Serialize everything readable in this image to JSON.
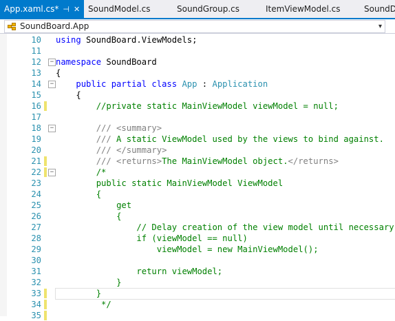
{
  "tabs": [
    {
      "label": "App.xaml.cs*",
      "active": true,
      "pin": "⊣",
      "close": "✕"
    },
    {
      "label": "SoundModel.cs",
      "active": false
    },
    {
      "label": "SoundGroup.cs",
      "active": false
    },
    {
      "label": "ItemViewModel.cs",
      "active": false
    },
    {
      "label": "SoundDa",
      "active": false
    }
  ],
  "nav": {
    "label": "SoundBoard.App",
    "icon": "class-icon",
    "arrow": "chevron-down-icon"
  },
  "lines": [
    {
      "n": "10",
      "segs": [
        [
          "kw",
          "using"
        ],
        [
          "tx",
          " SoundBoard.ViewModels;"
        ]
      ]
    },
    {
      "n": "11",
      "segs": []
    },
    {
      "n": "12",
      "fold": "−",
      "segs": [
        [
          "kw",
          "namespace"
        ],
        [
          "tx",
          " SoundBoard"
        ]
      ]
    },
    {
      "n": "13",
      "segs": [
        [
          "tx",
          "{"
        ]
      ]
    },
    {
      "n": "14",
      "fold": "−",
      "segs": [
        [
          "tx",
          "    "
        ],
        [
          "kw",
          "public partial class"
        ],
        [
          "tx",
          " "
        ],
        [
          "ty",
          "App"
        ],
        [
          "tx",
          " : "
        ],
        [
          "ty",
          "Application"
        ]
      ]
    },
    {
      "n": "15",
      "segs": [
        [
          "tx",
          "    {"
        ]
      ]
    },
    {
      "n": "16",
      "changed": true,
      "segs": [
        [
          "tx",
          "        "
        ],
        [
          "cm",
          "//private static MainViewModel viewModel = null;"
        ]
      ]
    },
    {
      "n": "17",
      "segs": []
    },
    {
      "n": "18",
      "fold": "−",
      "segs": [
        [
          "tx",
          "        "
        ],
        [
          "xml",
          "/// <summary>"
        ]
      ]
    },
    {
      "n": "19",
      "segs": [
        [
          "tx",
          "        "
        ],
        [
          "xml",
          "///"
        ],
        [
          "cm",
          " A static ViewModel used by the views to bind against."
        ]
      ]
    },
    {
      "n": "20",
      "segs": [
        [
          "tx",
          "        "
        ],
        [
          "xml",
          "/// </summary>"
        ]
      ]
    },
    {
      "n": "21",
      "changed": true,
      "segs": [
        [
          "tx",
          "        "
        ],
        [
          "xml",
          "/// <returns>"
        ],
        [
          "cm",
          "The MainViewModel object."
        ],
        [
          "xml",
          "</returns>"
        ]
      ]
    },
    {
      "n": "22",
      "changed": true,
      "fold": "−",
      "segs": [
        [
          "tx",
          "        "
        ],
        [
          "cm",
          "/*"
        ]
      ]
    },
    {
      "n": "23",
      "segs": [
        [
          "tx",
          "        "
        ],
        [
          "cm",
          "public static MainViewModel ViewModel"
        ]
      ]
    },
    {
      "n": "24",
      "segs": [
        [
          "tx",
          "        "
        ],
        [
          "cm",
          "{"
        ]
      ]
    },
    {
      "n": "25",
      "segs": [
        [
          "tx",
          "            "
        ],
        [
          "cm",
          "get"
        ]
      ]
    },
    {
      "n": "26",
      "segs": [
        [
          "tx",
          "            "
        ],
        [
          "cm",
          "{"
        ]
      ]
    },
    {
      "n": "27",
      "segs": [
        [
          "tx",
          "                "
        ],
        [
          "cm",
          "// Delay creation of the view model until necessary"
        ]
      ]
    },
    {
      "n": "28",
      "segs": [
        [
          "tx",
          "                "
        ],
        [
          "cm",
          "if (viewModel == null)"
        ]
      ]
    },
    {
      "n": "29",
      "segs": [
        [
          "tx",
          "                    "
        ],
        [
          "cm",
          "viewModel = new MainViewModel();"
        ]
      ]
    },
    {
      "n": "30",
      "segs": []
    },
    {
      "n": "31",
      "segs": [
        [
          "tx",
          "                "
        ],
        [
          "cm",
          "return viewModel;"
        ]
      ]
    },
    {
      "n": "32",
      "segs": [
        [
          "tx",
          "            "
        ],
        [
          "cm",
          "}"
        ]
      ]
    },
    {
      "n": "33",
      "changed": true,
      "current": true,
      "segs": [
        [
          "tx",
          "        "
        ],
        [
          "cm",
          "}"
        ]
      ]
    },
    {
      "n": "34",
      "changed": true,
      "segs": [
        [
          "tx",
          "         "
        ],
        [
          "cm",
          "*/"
        ]
      ]
    },
    {
      "n": "35",
      "changed": true,
      "segs": []
    }
  ]
}
